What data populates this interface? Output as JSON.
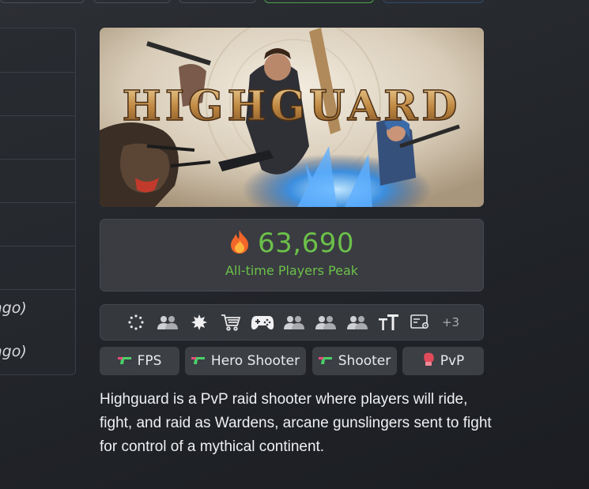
{
  "left_table": {
    "rows": [
      {
        "text": ""
      },
      {
        "text": ""
      },
      {
        "text": ""
      },
      {
        "text": ""
      },
      {
        "text": ""
      },
      {
        "text": "ago)"
      },
      {
        "text": "ago)"
      }
    ]
  },
  "game": {
    "title_art": "HIGHGUARD",
    "players_peak": "63,690",
    "players_peak_label": "All-time Players Peak",
    "description": "Highguard is a PvP raid shooter where players will ride, fight, and raid as Wardens, arcane gunslingers sent to fight for control of a mythical continent."
  },
  "features": {
    "icons": [
      "loading-icon",
      "multiplayer-icon",
      "achievements-icon",
      "cart-icon",
      "controller-icon",
      "co-op-icon",
      "online-pvp-icon",
      "team-icon",
      "text-size-icon",
      "settings-panel-icon"
    ],
    "more_label": "+3"
  },
  "tags": [
    {
      "label": "FPS",
      "icon": "gun-icon"
    },
    {
      "label": "Hero Shooter",
      "icon": "gun-icon"
    },
    {
      "label": "Shooter",
      "icon": "gun-icon"
    },
    {
      "label": "PvP",
      "icon": "boxing-glove-icon"
    }
  ],
  "colors": {
    "accent_green": "#6cc04a",
    "background": "#23262b",
    "card": "#3a3c41"
  }
}
